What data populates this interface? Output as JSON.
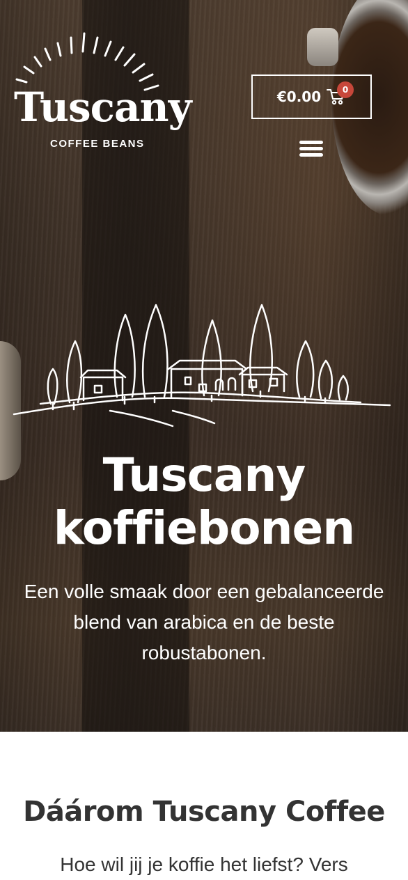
{
  "header": {
    "logo": {
      "title": "Tuscany",
      "subtitle": "COFFEE BEANS"
    },
    "cart": {
      "amount": "€0.00",
      "count": "0",
      "icon": "cart-icon"
    },
    "menu_icon": "hamburger-menu-icon"
  },
  "hero": {
    "title_line1": "Tuscany",
    "title_line2": "koffiebonen",
    "subtitle": "Een volle smaak door een gebalanceerde blend van arabica en de beste robustabonen."
  },
  "section": {
    "heading": "Dáárom Tuscany Coffee",
    "text": "Hoe wil jij je koffie het liefst? Vers"
  },
  "colors": {
    "badge": "#c7473a",
    "heading": "#333333",
    "hero_text": "#ffffff"
  }
}
